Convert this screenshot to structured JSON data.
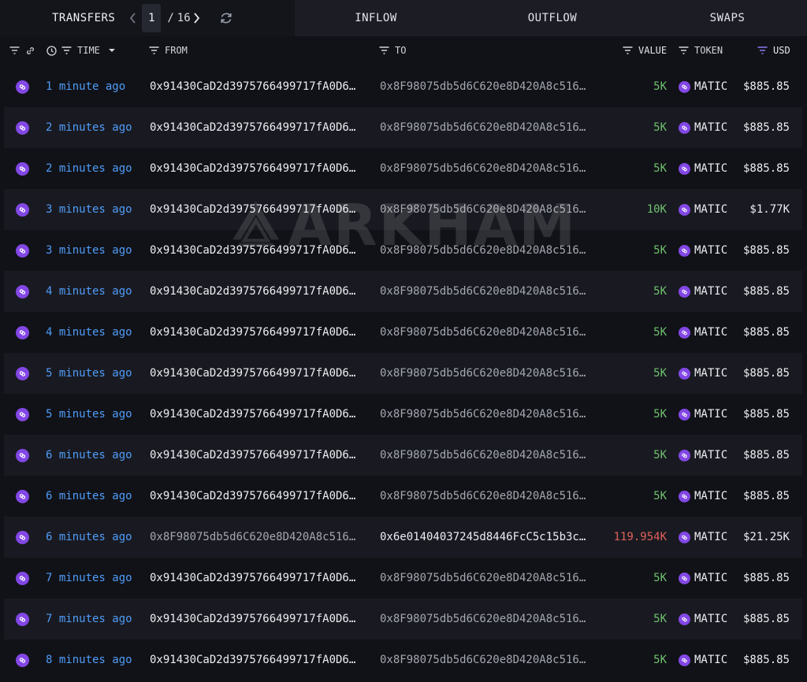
{
  "topbar": {
    "title": "TRANSFERS",
    "page_current": "1",
    "page_separator": "/",
    "page_total": "16",
    "tabs": [
      "INFLOW",
      "OUTFLOW",
      "SWAPS"
    ]
  },
  "columns": {
    "time": "TIME",
    "from": "FROM",
    "to": "TO",
    "value": "VALUE",
    "token": "TOKEN",
    "usd": "USD"
  },
  "watermark": "ARKHAM",
  "colors": {
    "time_link": "#4f9cf9",
    "value_positive": "#6fc06f",
    "value_negative": "#e0605a",
    "token_icon": "#8247e5",
    "usd_filter_active": "#8b7cf6"
  },
  "rows": [
    {
      "time": "1 minute ago",
      "from": "0x91430CaD2d3975766499717fA0D6…",
      "to": "0x8F98075db5d6C620e8D420A8c516…",
      "value": "5K",
      "token": "MATIC",
      "usd": "$885.85"
    },
    {
      "time": "2 minutes ago",
      "from": "0x91430CaD2d3975766499717fA0D6…",
      "to": "0x8F98075db5d6C620e8D420A8c516…",
      "value": "5K",
      "token": "MATIC",
      "usd": "$885.85"
    },
    {
      "time": "2 minutes ago",
      "from": "0x91430CaD2d3975766499717fA0D6…",
      "to": "0x8F98075db5d6C620e8D420A8c516…",
      "value": "5K",
      "token": "MATIC",
      "usd": "$885.85"
    },
    {
      "time": "3 minutes ago",
      "from": "0x91430CaD2d3975766499717fA0D6…",
      "to": "0x8F98075db5d6C620e8D420A8c516…",
      "value": "10K",
      "token": "MATIC",
      "usd": "$1.77K"
    },
    {
      "time": "3 minutes ago",
      "from": "0x91430CaD2d3975766499717fA0D6…",
      "to": "0x8F98075db5d6C620e8D420A8c516…",
      "value": "5K",
      "token": "MATIC",
      "usd": "$885.85"
    },
    {
      "time": "4 minutes ago",
      "from": "0x91430CaD2d3975766499717fA0D6…",
      "to": "0x8F98075db5d6C620e8D420A8c516…",
      "value": "5K",
      "token": "MATIC",
      "usd": "$885.85"
    },
    {
      "time": "4 minutes ago",
      "from": "0x91430CaD2d3975766499717fA0D6…",
      "to": "0x8F98075db5d6C620e8D420A8c516…",
      "value": "5K",
      "token": "MATIC",
      "usd": "$885.85"
    },
    {
      "time": "5 minutes ago",
      "from": "0x91430CaD2d3975766499717fA0D6…",
      "to": "0x8F98075db5d6C620e8D420A8c516…",
      "value": "5K",
      "token": "MATIC",
      "usd": "$885.85"
    },
    {
      "time": "5 minutes ago",
      "from": "0x91430CaD2d3975766499717fA0D6…",
      "to": "0x8F98075db5d6C620e8D420A8c516…",
      "value": "5K",
      "token": "MATIC",
      "usd": "$885.85"
    },
    {
      "time": "6 minutes ago",
      "from": "0x91430CaD2d3975766499717fA0D6…",
      "to": "0x8F98075db5d6C620e8D420A8c516…",
      "value": "5K",
      "token": "MATIC",
      "usd": "$885.85"
    },
    {
      "time": "6 minutes ago",
      "from": "0x91430CaD2d3975766499717fA0D6…",
      "to": "0x8F98075db5d6C620e8D420A8c516…",
      "value": "5K",
      "token": "MATIC",
      "usd": "$885.85"
    },
    {
      "time": "6 minutes ago",
      "from": "0x8F98075db5d6C620e8D420A8c516…",
      "to": "0x6e01404037245d8446FcC5c15b3c…",
      "value": "119.954K",
      "token": "MATIC",
      "usd": "$21.25K",
      "outgoing": true
    },
    {
      "time": "7 minutes ago",
      "from": "0x91430CaD2d3975766499717fA0D6…",
      "to": "0x8F98075db5d6C620e8D420A8c516…",
      "value": "5K",
      "token": "MATIC",
      "usd": "$885.85"
    },
    {
      "time": "7 minutes ago",
      "from": "0x91430CaD2d3975766499717fA0D6…",
      "to": "0x8F98075db5d6C620e8D420A8c516…",
      "value": "5K",
      "token": "MATIC",
      "usd": "$885.85"
    },
    {
      "time": "8 minutes ago",
      "from": "0x91430CaD2d3975766499717fA0D6…",
      "to": "0x8F98075db5d6C620e8D420A8c516…",
      "value": "5K",
      "token": "MATIC",
      "usd": "$885.85"
    }
  ]
}
